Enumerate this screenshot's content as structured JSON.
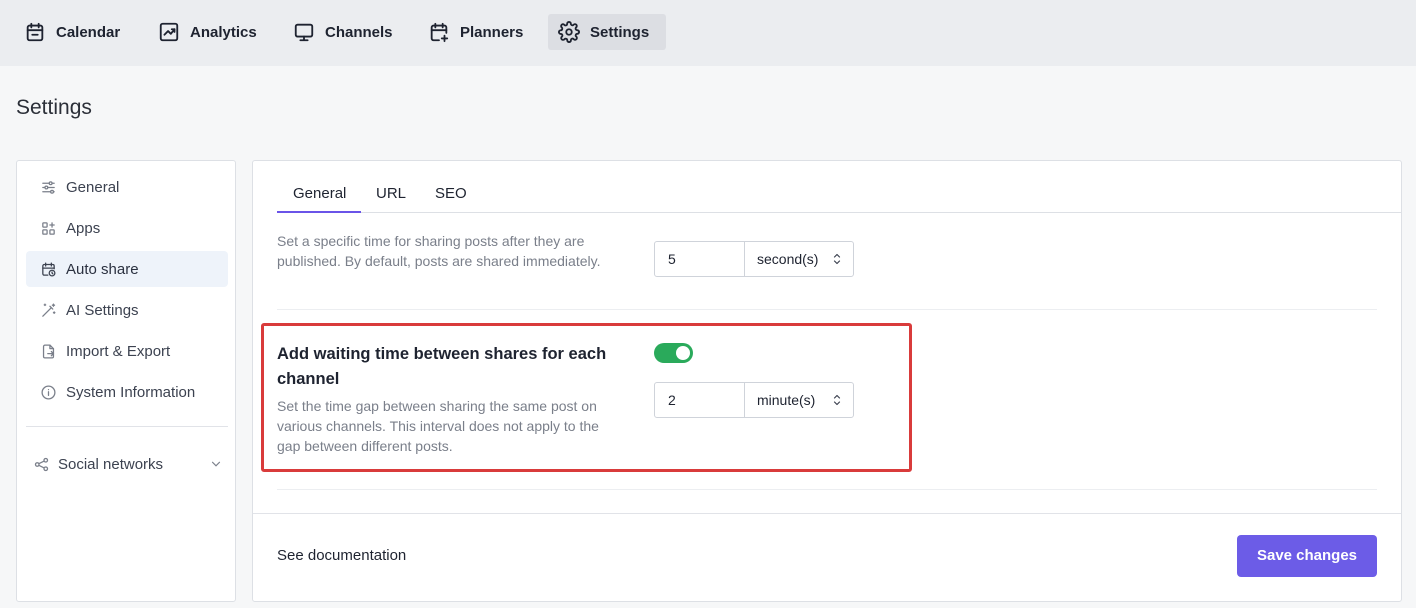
{
  "nav": {
    "items": [
      {
        "label": "Calendar",
        "icon": "calendar-icon"
      },
      {
        "label": "Analytics",
        "icon": "analytics-icon"
      },
      {
        "label": "Channels",
        "icon": "monitor-icon"
      },
      {
        "label": "Planners",
        "icon": "calendar-plus-icon"
      },
      {
        "label": "Settings",
        "icon": "gear-icon",
        "active": true
      }
    ]
  },
  "page": {
    "title": "Settings"
  },
  "sidebar": {
    "items": [
      {
        "label": "General",
        "icon": "sliders-icon"
      },
      {
        "label": "Apps",
        "icon": "apps-icon"
      },
      {
        "label": "Auto share",
        "icon": "calendar-clock-icon",
        "active": true
      },
      {
        "label": "AI Settings",
        "icon": "magic-wand-icon"
      },
      {
        "label": "Import & Export",
        "icon": "file-export-icon"
      },
      {
        "label": "System Information",
        "icon": "info-icon"
      }
    ],
    "social": {
      "label": "Social networks",
      "icon": "share-nodes-icon"
    }
  },
  "tabs": [
    {
      "label": "General",
      "active": true
    },
    {
      "label": "URL"
    },
    {
      "label": "SEO"
    }
  ],
  "delay_setting": {
    "description_line1": "Set a specific time for sharing posts after they are",
    "description_line2": "published. By default, posts are shared immediately.",
    "value": "5",
    "unit": "second(s)"
  },
  "waiting_setting": {
    "title_line1": "Add waiting time between shares for each",
    "title_line2": "channel",
    "description_line1": "Set the time gap between sharing the same post on",
    "description_line2": "various channels. This interval does not apply to the",
    "description_line3": "gap between different posts.",
    "enabled": true,
    "value": "2",
    "unit": "minute(s)"
  },
  "footer": {
    "doc_link": "See documentation",
    "save_label": "Save changes"
  },
  "colors": {
    "accent": "#6c5ce7",
    "toggle_on": "#2aaa5b",
    "highlight": "#d93b3b"
  }
}
